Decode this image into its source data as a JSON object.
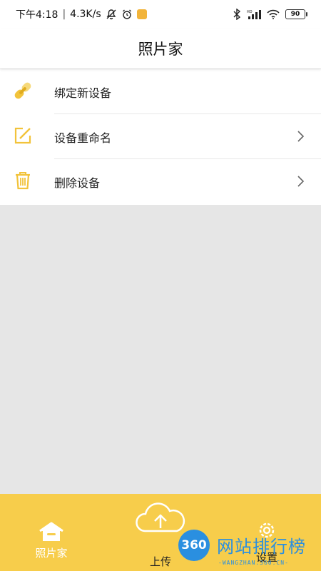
{
  "status_bar": {
    "time": "下午4:18",
    "net_speed": "4.3K/s",
    "battery": "90",
    "icons": [
      "mute-icon",
      "alarm-icon",
      "app-notification-icon",
      "bluetooth-icon",
      "hd-signal-icon",
      "wifi-icon",
      "battery-icon"
    ]
  },
  "header": {
    "title": "照片家"
  },
  "menu": {
    "items": [
      {
        "label": "绑定新设备",
        "icon": "link-icon",
        "has_chevron": false
      },
      {
        "label": "设备重命名",
        "icon": "edit-icon",
        "has_chevron": true
      },
      {
        "label": "删除设备",
        "icon": "trash-icon",
        "has_chevron": true
      }
    ]
  },
  "bottom_nav": {
    "tabs": [
      {
        "label": "照片家",
        "icon": "home-icon"
      },
      {
        "label": "上传",
        "icon": "cloud-upload-icon"
      },
      {
        "label": "设置",
        "icon": "settings-icon"
      }
    ]
  },
  "watermark": {
    "badge": "360",
    "title": "网站排行榜",
    "subtitle": "-WANGZHAN.360.CN-"
  },
  "colors": {
    "accent": "#f7cd4b",
    "icon_yellow": "#f2c33b",
    "background": "#e6e6e6",
    "watermark_blue": "#2a8fe0"
  }
}
